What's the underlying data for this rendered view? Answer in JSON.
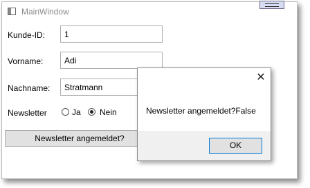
{
  "window": {
    "title": "MainWindow",
    "icon": "window-icon",
    "maximize_icon": "maximize-icon"
  },
  "form": {
    "customer_id": {
      "label": "Kunde-ID:",
      "value": "1"
    },
    "first_name": {
      "label": "Vorname:",
      "value": "Adi"
    },
    "last_name": {
      "label": "Nachname:",
      "value": "Stratmann"
    },
    "newsletter": {
      "label": "Newsletter",
      "options": [
        {
          "label": "Ja",
          "checked": false
        },
        {
          "label": "Nein",
          "checked": true
        }
      ]
    },
    "check_button_label": "Newsletter angemeldet?"
  },
  "message_box": {
    "message": "Newsletter angemeldet?False",
    "ok_label": "OK",
    "close_glyph": "✕",
    "close_icon": "close-icon"
  }
}
